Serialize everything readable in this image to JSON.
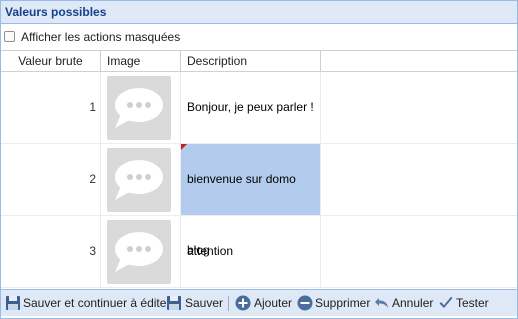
{
  "panel": {
    "title": "Valeurs possibles"
  },
  "options": {
    "show_hidden_label": "Afficher les actions masquées",
    "show_hidden_checked": false
  },
  "grid": {
    "columns": [
      "Valeur brute",
      "Image",
      "Description"
    ],
    "rows": [
      {
        "value": "1",
        "image": "chat-bubble-icon",
        "description": "Bonjour, je peux parler !"
      },
      {
        "value": "2",
        "image": "chat-bubble-icon",
        "description": "bienvenue sur domo blog"
      },
      {
        "value": "3",
        "image": "chat-bubble-icon",
        "description": "attention"
      }
    ]
  },
  "toolbar": {
    "save_continue": "Sauver et continuer à éditer",
    "save": "Sauver",
    "add": "Ajouter",
    "delete": "Supprimer",
    "cancel": "Annuler",
    "test": "Tester"
  },
  "colors": {
    "header_bg": "#dfe8f6",
    "title": "#15428b",
    "selected_cell": "#b3cbec",
    "dirty_marker": "#c81e1e"
  }
}
